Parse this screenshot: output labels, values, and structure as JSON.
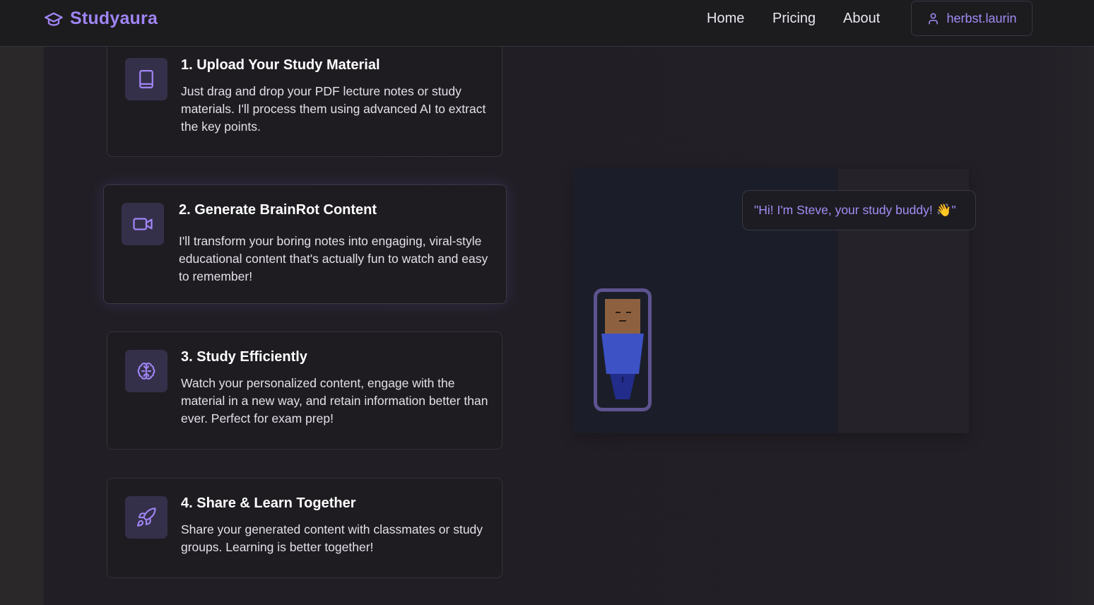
{
  "header": {
    "brand": "Studyaura",
    "nav": [
      "Home",
      "Pricing",
      "About"
    ],
    "user": "herbst.laurin"
  },
  "steps": [
    {
      "title": "1. Upload Your Study Material",
      "description": "Just drag and drop your PDF lecture notes or study materials. I'll process them using advanced AI to extract the key points.",
      "icon": "book-icon"
    },
    {
      "title": "2. Generate BrainRot Content",
      "description": "I'll transform your boring notes into engaging, viral-style educational content that's actually fun to watch and easy to remember!",
      "icon": "video-icon"
    },
    {
      "title": "3. Study Efficiently",
      "description": "Watch your personalized content, engage with the material in a new way, and retain information better than ever. Perfect for exam prep!",
      "icon": "brain-icon"
    },
    {
      "title": "4. Share & Learn Together",
      "description": "Share your generated content with classmates or study groups. Learning is better together!",
      "icon": "rocket-icon"
    }
  ],
  "buddy": {
    "speech": "\"Hi! I'm Steve, your study buddy! 👋\""
  },
  "colors": {
    "accent": "#9f85f3",
    "icon_bg": "#35304a",
    "card_bg": "#1e1c21",
    "header_bg": "#1c1b1e"
  }
}
